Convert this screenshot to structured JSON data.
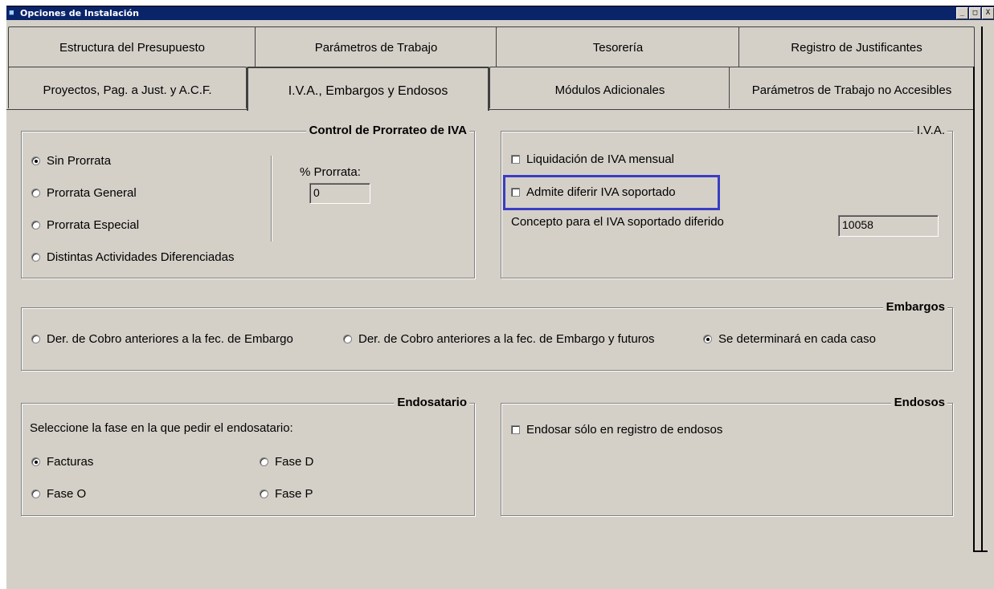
{
  "window": {
    "title": "Opciones de Instalación",
    "controls": [
      "_",
      "□",
      "X"
    ]
  },
  "tabs": {
    "row1": [
      "Estructura del Presupuesto",
      "Parámetros de Trabajo",
      "Tesorería",
      "Registro de Justificantes"
    ],
    "row2": [
      "Proyectos, Pag. a Just. y A.C.F.",
      "I.V.A., Embargos y Endosos",
      "Módulos Adicionales",
      "Parámetros de Trabajo no Accesibles"
    ],
    "active": "I.V.A., Embargos y Endosos"
  },
  "prorrateo": {
    "title": "Control de Prorrateo de IVA",
    "options": [
      "Sin Prorrata",
      "Prorrata General",
      "Prorrata Especial",
      "Distintas Actividades Diferenciadas"
    ],
    "selected": "Sin Prorrata",
    "percent_label": "% Prorrata:",
    "percent_value": "0"
  },
  "iva": {
    "title": "I.V.A.",
    "liquidacion_label": "Liquidación de IVA mensual",
    "liquidacion_checked": false,
    "diferir_label": "Admite diferir IVA soportado",
    "diferir_checked": false,
    "concepto_label": "Concepto para el IVA soportado diferido",
    "concepto_value": "10058",
    "highlight_color": "#3a3dc4"
  },
  "embargos": {
    "title": "Embargos",
    "options": [
      "Der. de Cobro anteriores a la fec. de Embargo",
      "Der. de Cobro anteriores a la fec. de Embargo y futuros",
      "Se determinará en cada caso"
    ],
    "selected": "Se determinará en cada caso"
  },
  "endosatario": {
    "title": "Endosatario",
    "prompt": "Seleccione la fase en la que pedir el endosatario:",
    "options": [
      "Facturas",
      "Fase D",
      "Fase O",
      "Fase P"
    ],
    "selected": "Facturas"
  },
  "endosos": {
    "title": "Endosos",
    "checkbox_label": "Endosar sólo en registro de endosos",
    "checked": false
  }
}
